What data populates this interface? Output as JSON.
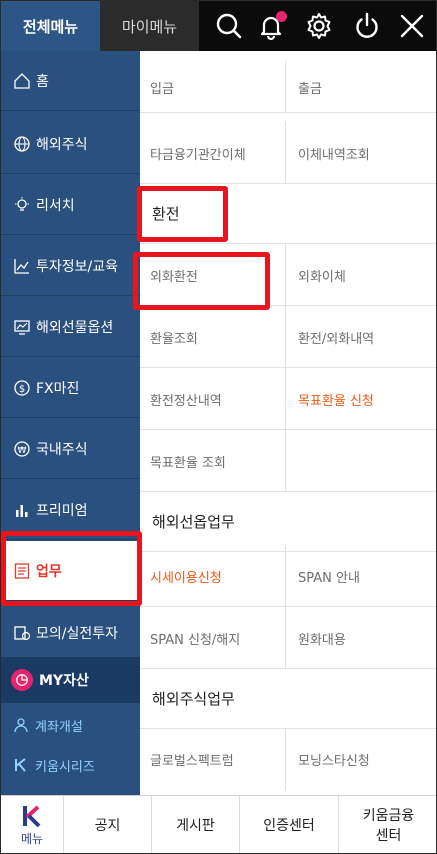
{
  "top_tabs": {
    "all_menu": "전체메뉴",
    "my_menu": "마이메뉴"
  },
  "top_icons": [
    "search-icon",
    "bell-icon",
    "gear-icon",
    "power-icon",
    "close-icon"
  ],
  "sidebar": {
    "items": [
      {
        "label": "홈",
        "icon": "home-icon"
      },
      {
        "label": "해외주식",
        "icon": "globe-icon"
      },
      {
        "label": "리서치",
        "icon": "bulb-icon"
      },
      {
        "label": "투자정보/교육",
        "icon": "chart-line-icon"
      },
      {
        "label": "해외선물옵션",
        "icon": "monitor-chart-icon"
      },
      {
        "label": "FX마진",
        "icon": "dollar-icon"
      },
      {
        "label": "국내주식",
        "icon": "won-icon"
      },
      {
        "label": "프리미엄",
        "icon": "bar-chart-icon"
      },
      {
        "label": "업무",
        "icon": "checklist-icon",
        "active": true
      },
      {
        "label": "모의/실전투자",
        "icon": "coin-icon"
      }
    ],
    "my_assets": "MY자산",
    "sub_items": [
      {
        "label": "계좌개설",
        "icon": "person-icon"
      },
      {
        "label": "키움시리즈",
        "icon": "k-icon"
      }
    ]
  },
  "content": {
    "rows_top": [
      [
        "입금",
        "출금"
      ],
      [
        "타금융기관간이체",
        "이체내역조회"
      ]
    ],
    "section_exchange": "환전",
    "rows_exchange": [
      [
        "외화환전",
        "외화이체"
      ],
      [
        "환율조회",
        "환전/외화내역"
      ],
      [
        "환전정산내역",
        "목표환율 신청"
      ],
      [
        "목표환율 조회",
        ""
      ]
    ],
    "section_futures": "해외선옵업무",
    "rows_futures": [
      [
        "시세이용신청",
        "SPAN 안내"
      ],
      [
        "SPAN 신청/해지",
        "원화대용"
      ]
    ],
    "section_stocks": "해외주식업무",
    "rows_stocks": [
      [
        "글로벌스펙트럼",
        "모닝스타신청"
      ]
    ]
  },
  "colors": {
    "sidebar": "#2a5080",
    "active_text": "#e03a2c",
    "orange_link": "#e85a1c",
    "highlight": "#e8161c",
    "accent_pink": "#e6246f"
  },
  "bottom_bar": {
    "menu": "메뉴",
    "items": [
      "공지",
      "게시판",
      "인증센터",
      "키움금융\n센터"
    ]
  }
}
